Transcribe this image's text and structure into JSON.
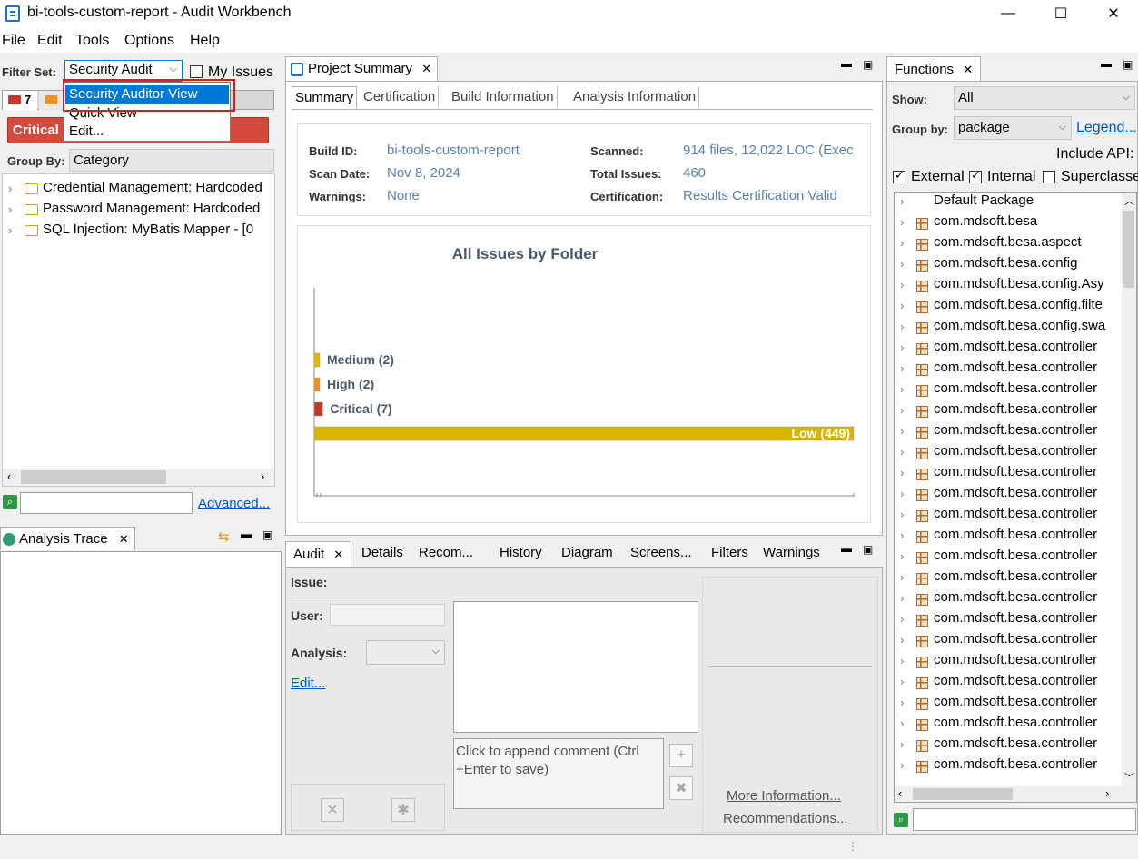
{
  "window": {
    "title": "bi-tools-custom-report - Audit Workbench",
    "minimize": "—",
    "maximize": "☐",
    "close": "✕"
  },
  "menu": [
    "File",
    "Edit",
    "Tools",
    "Options",
    "Help"
  ],
  "filter": {
    "label": "Filter Set:",
    "selected": "Security Audit",
    "my_issues": "My Issues",
    "options": [
      "Security Auditor View",
      "Quick View",
      "Edit..."
    ],
    "critical_count": "7",
    "critical_label": "Critical",
    "group_by_label": "Group By:",
    "group_by_value": "Category",
    "tree": [
      "Credential Management: Hardcoded",
      "Password Management: Hardcoded",
      "SQL Injection: MyBatis Mapper - [0"
    ],
    "advanced_link": "Advanced..."
  },
  "analysis_trace": {
    "title": "Analysis Trace"
  },
  "project_summary": {
    "title": "Project Summary",
    "tabs": [
      "Summary",
      "Certification",
      "Build Information",
      "Analysis Information"
    ],
    "info": {
      "build_id_label": "Build ID:",
      "build_id": "bi-tools-custom-report",
      "scan_date_label": "Scan Date:",
      "scan_date": "Nov 8, 2024",
      "warnings_label": "Warnings:",
      "warnings": "None",
      "scanned_label": "Scanned:",
      "scanned": "914 files, 12,022 LOC (Exec",
      "total_issues_label": "Total Issues:",
      "total_issues": "460",
      "certification_label": "Certification:",
      "certification": "Results Certification Valid"
    }
  },
  "chart_data": {
    "type": "bar",
    "title": "All Issues by Folder",
    "orientation": "horizontal",
    "categories": [
      "Medium",
      "High",
      "Critical",
      "Low"
    ],
    "values": [
      2,
      2,
      7,
      449
    ],
    "labels": [
      "Medium (2)",
      "High (2)",
      "Critical (7)",
      "Low (449)"
    ],
    "colors": [
      "#e6b800",
      "#f0901e",
      "#c0392b",
      "#d9b400"
    ],
    "xlim": [
      0,
      449
    ]
  },
  "audit": {
    "tabs": [
      "Audit",
      "Details",
      "Recom...",
      "History",
      "Diagram",
      "Screens...",
      "Filters",
      "Warnings"
    ],
    "issue_label": "Issue:",
    "user_label": "User:",
    "analysis_label": "Analysis:",
    "edit_link": "Edit...",
    "comment_placeholder": "Click to append comment (Ctrl +Enter to save)",
    "more_info": "More Information...",
    "recommendations": "Recommendations..."
  },
  "functions": {
    "title": "Functions",
    "show_label": "Show:",
    "show_value": "All",
    "group_by_label": "Group by:",
    "group_by_value": "package",
    "legend_link": "Legend...",
    "include_api": "Include API:",
    "external": "External",
    "internal": "Internal",
    "superclasses": "Superclasse",
    "items": [
      "Default Package",
      "com.mdsoft.besa",
      "com.mdsoft.besa.aspect",
      "com.mdsoft.besa.config",
      "com.mdsoft.besa.config.Asy",
      "com.mdsoft.besa.config.filte",
      "com.mdsoft.besa.config.swa",
      "com.mdsoft.besa.controller",
      "com.mdsoft.besa.controller",
      "com.mdsoft.besa.controller",
      "com.mdsoft.besa.controller",
      "com.mdsoft.besa.controller",
      "com.mdsoft.besa.controller",
      "com.mdsoft.besa.controller",
      "com.mdsoft.besa.controller",
      "com.mdsoft.besa.controller",
      "com.mdsoft.besa.controller",
      "com.mdsoft.besa.controller",
      "com.mdsoft.besa.controller",
      "com.mdsoft.besa.controller",
      "com.mdsoft.besa.controller",
      "com.mdsoft.besa.controller",
      "com.mdsoft.besa.controller",
      "com.mdsoft.besa.controller",
      "com.mdsoft.besa.controller",
      "com.mdsoft.besa.controller",
      "com.mdsoft.besa.controller",
      "com.mdsoft.besa.controller"
    ]
  }
}
